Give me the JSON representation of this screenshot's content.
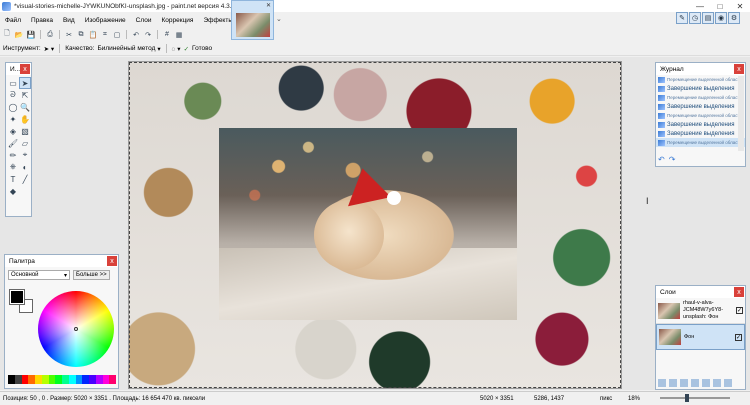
{
  "window": {
    "title": "*visual-stories-michelle-JYWKUNObfKI-unsplash.jpg - paint.net версия 4.3.4",
    "controls": [
      "—",
      "□",
      "✕"
    ]
  },
  "menu": [
    "Файл",
    "Правка",
    "Вид",
    "Изображение",
    "Слои",
    "Коррекция",
    "Эффекты"
  ],
  "tabs": {
    "close": "✕",
    "more": "⌄"
  },
  "toolbar2": {
    "tool_label": "Инструмент:",
    "quality_label": "Качество:",
    "quality_value": "Билинейный метод",
    "done_label": "Готово"
  },
  "tools_panel": {
    "title": "И...",
    "close": "x"
  },
  "palette": {
    "title": "Палитра",
    "close": "x",
    "mode": "Основной",
    "more_button": "Больше >>"
  },
  "history": {
    "title": "Журнал",
    "close": "x",
    "items": [
      {
        "label": "Перемещение выделенной области",
        "small": true
      },
      {
        "label": "Завершение выделения",
        "small": false
      },
      {
        "label": "Перемещение выделенной области",
        "small": true
      },
      {
        "label": "Завершение выделения",
        "small": false
      },
      {
        "label": "Перемещение выделенной области",
        "small": true
      },
      {
        "label": "Завершение выделения",
        "small": false
      },
      {
        "label": "Завершение выделения",
        "small": false
      },
      {
        "label": "Перемещение выделенной области",
        "small": true
      }
    ]
  },
  "layers": {
    "title": "Слои",
    "close": "x",
    "items": [
      {
        "name": "rhaul-v-alva-JCM48W7y6Y8-unsplash: Фон",
        "checked": "✓"
      },
      {
        "name": "Фон",
        "checked": "✓"
      }
    ]
  },
  "status": {
    "position": "Позиция: 50 , 0 . Размер: 5020 × 3351 . Площадь: 16 654 470 кв. пиксели",
    "image_size": "5020 × 3351",
    "cursor": "5286, 1437",
    "unit": "пикс",
    "zoom": "18%"
  }
}
